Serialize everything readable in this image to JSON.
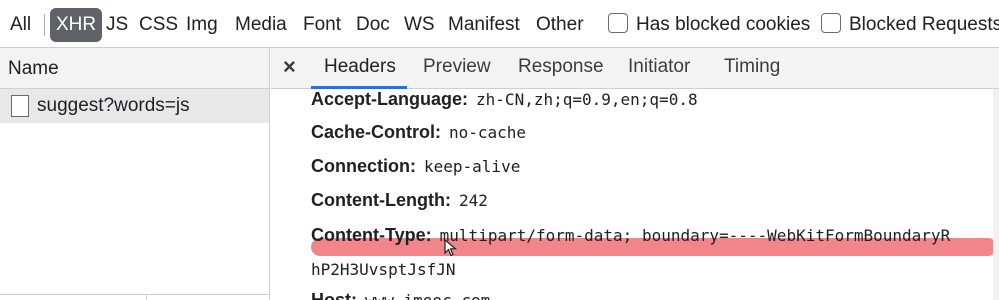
{
  "filter_bar": {
    "types": [
      "All",
      "XHR",
      "JS",
      "CSS",
      "Img",
      "Media",
      "Font",
      "Doc",
      "WS",
      "Manifest",
      "Other"
    ],
    "active_type": "XHR",
    "checkboxes": [
      {
        "label": "Has blocked cookies",
        "checked": false
      },
      {
        "label": "Blocked Requests",
        "checked": false
      }
    ]
  },
  "request_list": {
    "column_header": "Name",
    "items": [
      {
        "name": "suggest?words=js",
        "selected": true
      }
    ]
  },
  "detail_tabs": {
    "close_symbol": "×",
    "tabs": [
      "Headers",
      "Preview",
      "Response",
      "Initiator",
      "Timing"
    ],
    "active": "Headers"
  },
  "headers": [
    {
      "key": "Accept-Language:",
      "value": "zh-CN,zh;q=0.9,en;q=0.8"
    },
    {
      "key": "Cache-Control:",
      "value": "no-cache"
    },
    {
      "key": "Connection:",
      "value": "keep-alive"
    },
    {
      "key": "Content-Length:",
      "value": "242"
    },
    {
      "key": "Content-Type:",
      "value": "multipart/form-data; boundary=----WebKitFormBoundaryR",
      "value_continued": "hP2H3UvsptJsfJN"
    },
    {
      "key": "Host:",
      "value": "www.imooc.com"
    }
  ],
  "colors": {
    "active_filter_bg": "#5f6368",
    "tab_underline": "#1a73e8",
    "highlight": "#ef6a70",
    "selected_row": "#e8e8e8"
  }
}
